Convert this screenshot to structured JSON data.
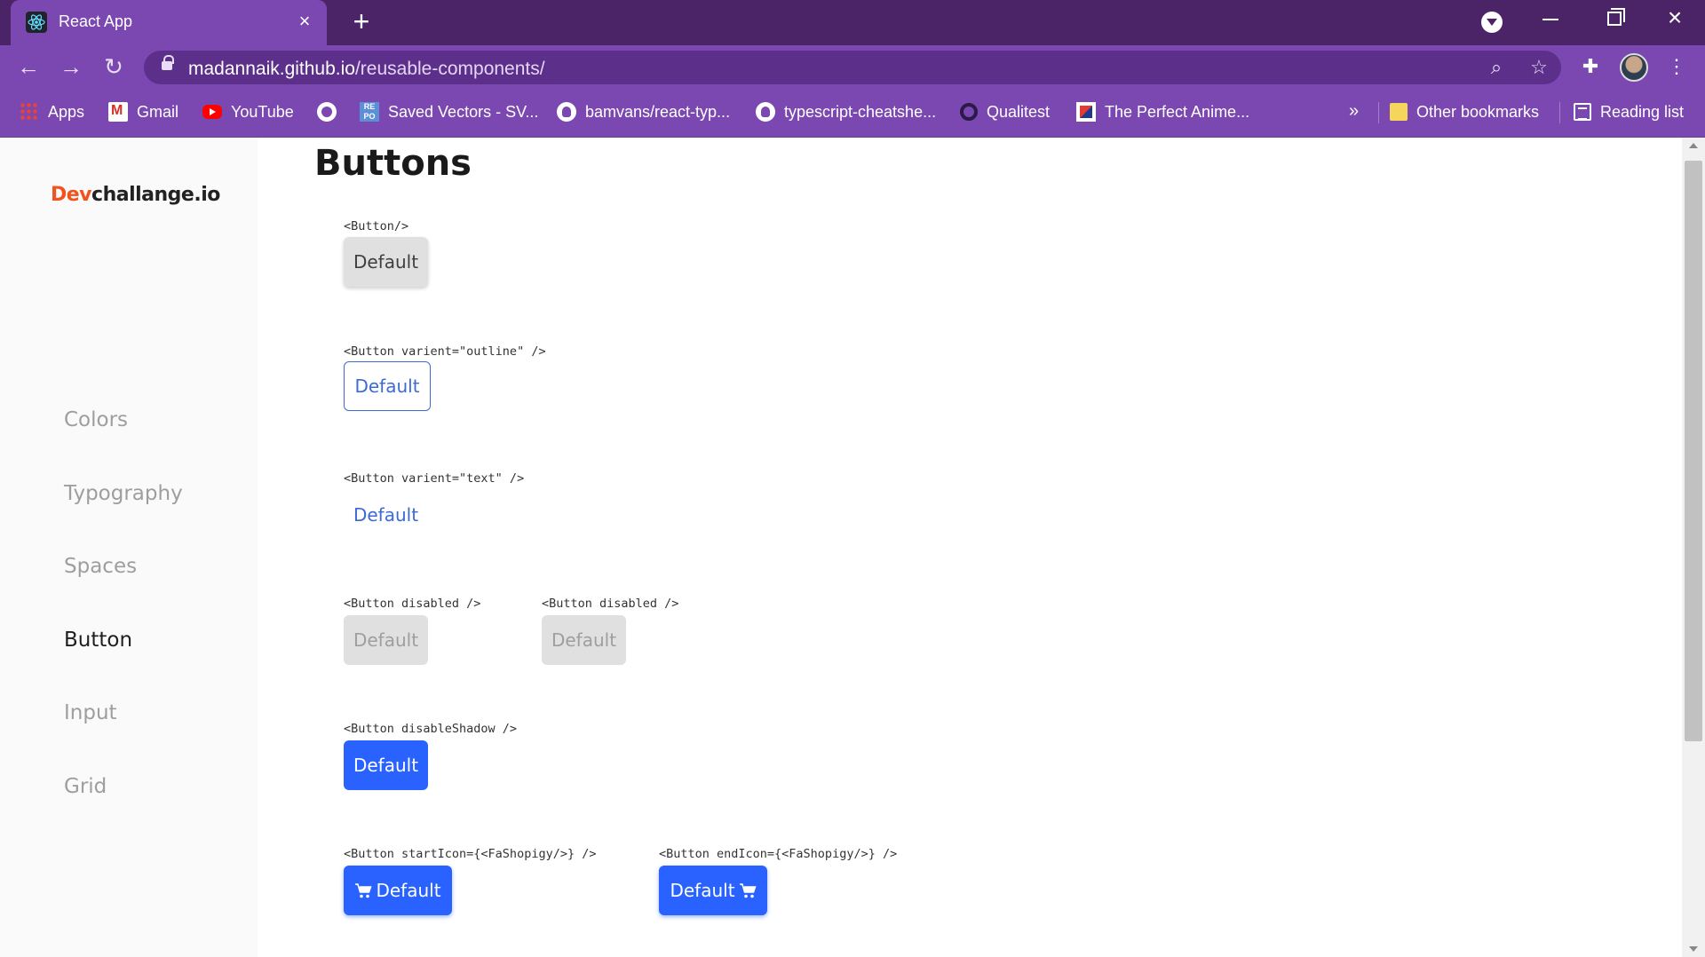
{
  "browser": {
    "tab_title": "React App",
    "url_host": "madannaik.github.io",
    "url_path": "/reusable-components/",
    "bookmarks": [
      {
        "label": "Apps",
        "icon": "apps-grid-icon"
      },
      {
        "label": "Gmail",
        "icon": "gmail-icon"
      },
      {
        "label": "YouTube",
        "icon": "youtube-icon"
      },
      {
        "label": "",
        "icon": "globe-icon"
      },
      {
        "label": "Saved Vectors - SV...",
        "icon": "repo-icon"
      },
      {
        "label": "bamvans/react-typ...",
        "icon": "github-icon"
      },
      {
        "label": "typescript-cheatshe...",
        "icon": "github-icon"
      },
      {
        "label": "Qualitest",
        "icon": "qualitest-icon"
      },
      {
        "label": "The Perfect Anime...",
        "icon": "anime-icon"
      }
    ],
    "more_bookmarks": "»",
    "other_bookmarks": "Other bookmarks",
    "reading_list": "Reading list"
  },
  "sidebar": {
    "logo_accent": "Dev",
    "logo_rest": "challange.io",
    "items": [
      {
        "label": "Colors",
        "active": false
      },
      {
        "label": "Typography",
        "active": false
      },
      {
        "label": "Spaces",
        "active": false
      },
      {
        "label": "Button",
        "active": true
      },
      {
        "label": "Input",
        "active": false
      },
      {
        "label": "Grid",
        "active": false
      }
    ]
  },
  "main": {
    "title": "Buttons",
    "examples": [
      {
        "code": "<Button/>",
        "label": "Default",
        "variant": "default"
      },
      {
        "code": "<Button varient=\"outline\" />",
        "label": "Default",
        "variant": "outline"
      },
      {
        "code": "<Button varient=\"text\" />",
        "label": "Default",
        "variant": "text"
      },
      {
        "code": "<Button disabled />",
        "label": "Default",
        "variant": "disabled"
      },
      {
        "code": "<Button disabled />",
        "label": "Default",
        "variant": "disabled"
      },
      {
        "code": "<Button disableShadow />",
        "label": "Default",
        "variant": "primary"
      },
      {
        "code": "<Button startIcon={<FaShopigy/>} />",
        "label": "Default",
        "variant": "primary-start-icon"
      },
      {
        "code": "<Button endIcon={<FaShopigy/>} />",
        "label": "Default",
        "variant": "primary-end-icon"
      }
    ]
  },
  "colors": {
    "chrome_dark": "#4a2466",
    "chrome": "#7a48b0",
    "logo_accent": "#f2521b",
    "primary": "#2962ff",
    "outline": "#3d6ad6"
  }
}
